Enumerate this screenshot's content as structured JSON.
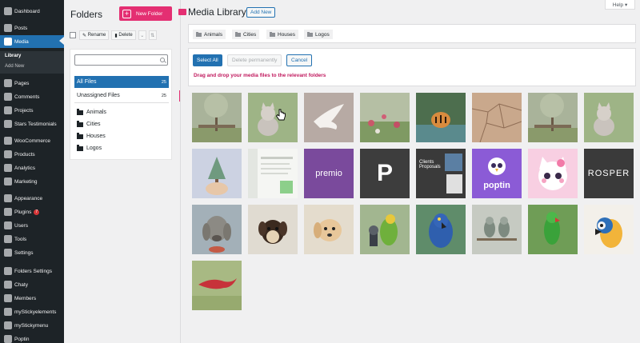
{
  "sidebar": {
    "items": [
      {
        "label": "Dashboard",
        "icon": "dashboard-icon"
      },
      {
        "label": "Posts",
        "icon": "pin-icon"
      },
      {
        "label": "Media",
        "icon": "media-icon",
        "active": true
      },
      {
        "label": "Pages",
        "icon": "page-icon"
      },
      {
        "label": "Comments",
        "icon": "comment-icon"
      },
      {
        "label": "Projects",
        "icon": "pin-icon"
      },
      {
        "label": "Stars Testimonials",
        "icon": "star-icon"
      },
      {
        "label": "WooCommerce",
        "icon": "woocommerce-icon"
      },
      {
        "label": "Products",
        "icon": "box-icon"
      },
      {
        "label": "Analytics",
        "icon": "chart-icon"
      },
      {
        "label": "Marketing",
        "icon": "megaphone-icon"
      },
      {
        "label": "Appearance",
        "icon": "brush-icon"
      },
      {
        "label": "Plugins",
        "icon": "plug-icon",
        "badge": "7"
      },
      {
        "label": "Users",
        "icon": "user-icon"
      },
      {
        "label": "Tools",
        "icon": "wrench-icon"
      },
      {
        "label": "Settings",
        "icon": "settings-icon"
      },
      {
        "label": "Folders Settings",
        "icon": "folder-icon"
      },
      {
        "label": "Chaty",
        "icon": "chat-icon"
      },
      {
        "label": "Members",
        "icon": "members-icon"
      },
      {
        "label": "myStickyelements",
        "icon": "sticky-icon"
      },
      {
        "label": "myStickymenu",
        "icon": "sticky-icon"
      },
      {
        "label": "Poptin",
        "icon": "poptin-icon"
      }
    ],
    "submenu": {
      "library": "Library",
      "add_new": "Add New"
    }
  },
  "folders": {
    "title": "Folders",
    "new_folder": "New Folder",
    "rename": "Rename",
    "delete": "Delete",
    "search_placeholder": "",
    "all_files": "All Files",
    "all_files_count": "25",
    "unassigned": "Unassigned Files",
    "unassigned_count": "25",
    "items": [
      "Animals",
      "Cities",
      "Houses",
      "Logos"
    ]
  },
  "main": {
    "title": "Media Library",
    "add_new": "Add New",
    "help": "Help ▾",
    "tags": [
      "Animals",
      "Cities",
      "Houses",
      "Logos"
    ],
    "select_all": "Select All",
    "delete_permanently": "Delete permanently",
    "cancel": "Cancel",
    "drag_hint": "Drag and drop your media files to the relevant folders"
  },
  "media": [
    {
      "name": "tree-swing",
      "bg": "#a9b39a",
      "kind": "tree"
    },
    {
      "name": "kitten",
      "bg": "#8fa57a",
      "kind": "kitten"
    },
    {
      "name": "white-dove",
      "bg": "#b7a9a3",
      "kind": "dove"
    },
    {
      "name": "wildflowers",
      "bg": "#a4b28f",
      "kind": "flowers"
    },
    {
      "name": "tiger",
      "bg": "#5e7d5a",
      "kind": "tiger"
    },
    {
      "name": "cracked-earth",
      "bg": "#c7a58a",
      "kind": "earth"
    },
    {
      "name": "tree-swing-2",
      "bg": "#a9b39a",
      "kind": "tree"
    },
    {
      "name": "kitten-2",
      "bg": "#8fa57a",
      "kind": "kitten"
    },
    {
      "name": "plant-in-hand",
      "bg": "#c9cfe0",
      "kind": "plant"
    },
    {
      "name": "dashboard-screenshot",
      "bg": "#f2f4f1",
      "kind": "screenshot"
    },
    {
      "name": "premio-logo",
      "bg": "#7a4a9c",
      "kind": "text",
      "text": "premio",
      "color": "#ffffff",
      "size": 11
    },
    {
      "name": "p-logo",
      "bg": "#3d3d3d",
      "kind": "text",
      "text": "P",
      "color": "#ffffff",
      "size": 30
    },
    {
      "name": "clients-proposals",
      "bg": "#3b3b3b",
      "kind": "proposals",
      "text": "Clients\nProposals"
    },
    {
      "name": "poptin-logo",
      "bg": "#8b5bd6",
      "kind": "poptin",
      "text": "poptin"
    },
    {
      "name": "cute-cat-illustration",
      "bg": "#f6c8dd",
      "kind": "catcartoon"
    },
    {
      "name": "prosper-logo",
      "bg": "#3a3a3a",
      "kind": "text",
      "text": "ROSPER",
      "color": "#ffffff",
      "size": 11
    },
    {
      "name": "weimaraner",
      "bg": "#99a7b1",
      "kind": "dog"
    },
    {
      "name": "puppy",
      "bg": "#d8d2c6",
      "kind": "puppy"
    },
    {
      "name": "puppy-2",
      "bg": "#e1d8c8",
      "kind": "puppy2"
    },
    {
      "name": "parrot-mic",
      "bg": "#9fb48d",
      "kind": "parrot"
    },
    {
      "name": "blue-macaw",
      "bg": "#5e8a6a",
      "kind": "macaw"
    },
    {
      "name": "lovebirds",
      "bg": "#c5c9c0",
      "kind": "lovebirds"
    },
    {
      "name": "green-parrot",
      "bg": "#6c9a54",
      "kind": "greenparrot"
    },
    {
      "name": "blue-gold-macaw",
      "bg": "#f1eee8",
      "kind": "bluegold"
    },
    {
      "name": "red-bird",
      "bg": "#a7b882",
      "kind": "redbird"
    }
  ]
}
